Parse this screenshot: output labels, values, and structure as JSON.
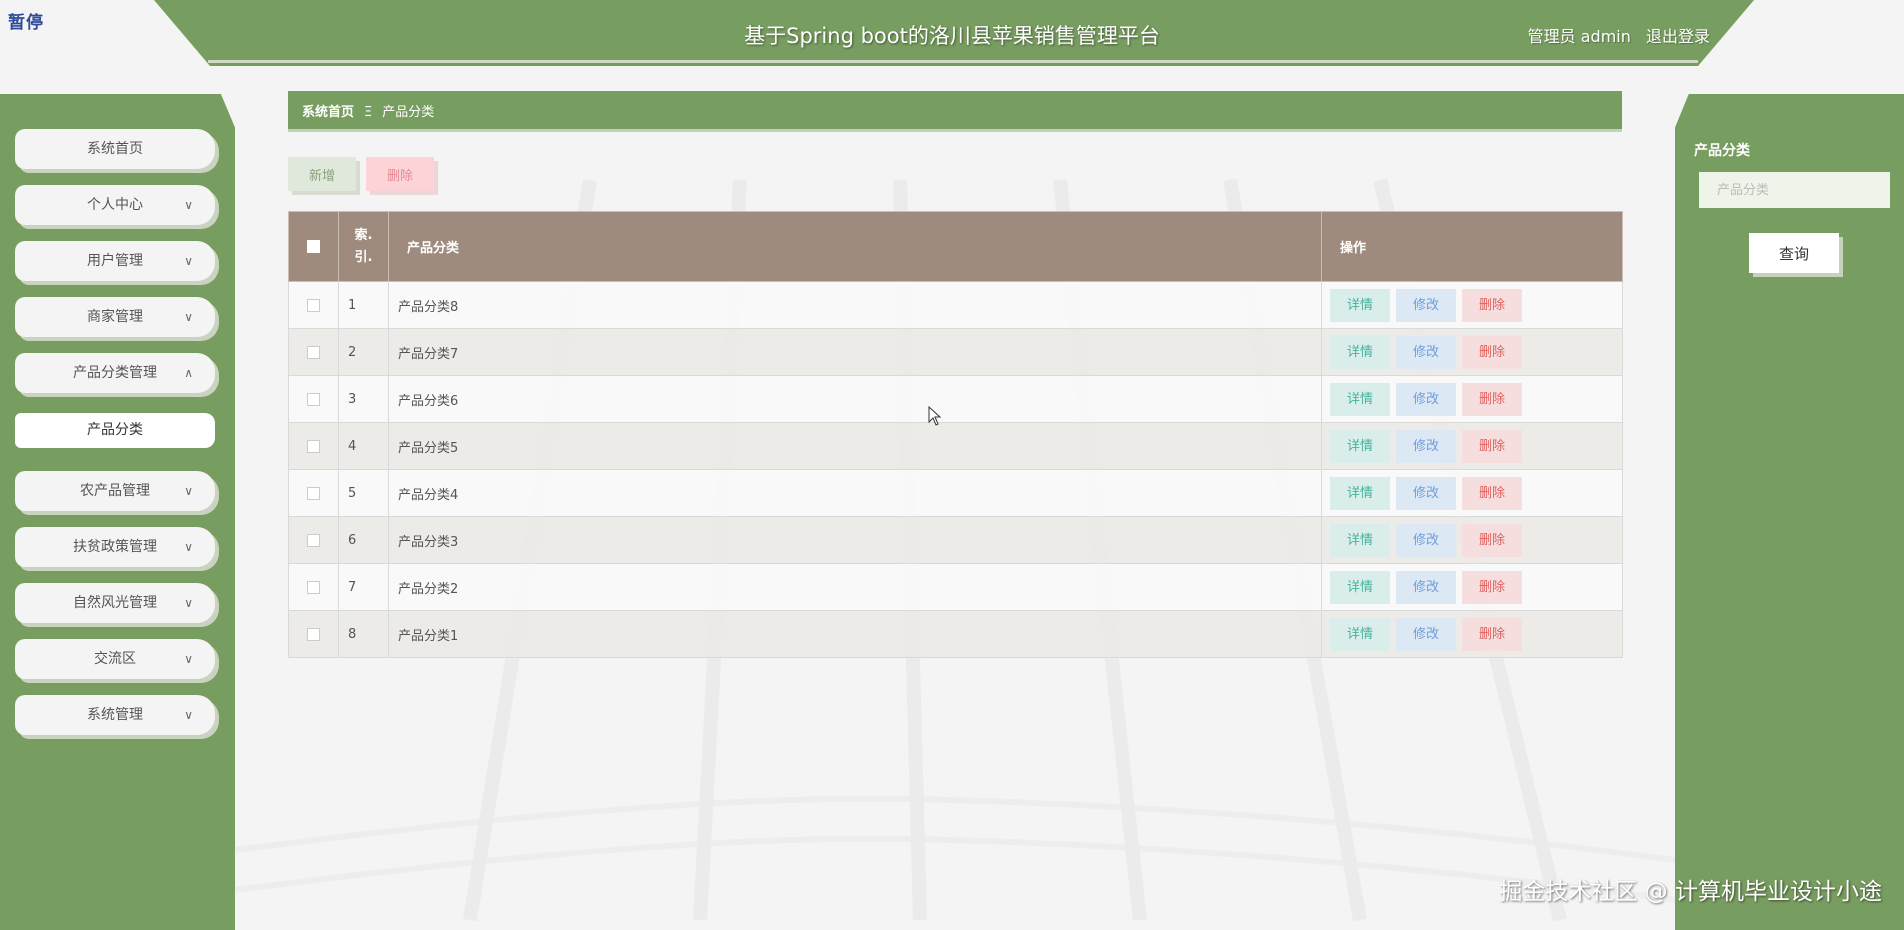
{
  "corner_logo": "暂停",
  "header": {
    "title": "基于Spring boot的洛川县苹果销售管理平台",
    "user_label": "管理员 admin",
    "logout": "退出登录"
  },
  "sidebar": {
    "items": [
      {
        "label": "系统首页"
      },
      {
        "label": "个人中心"
      },
      {
        "label": "用户管理"
      },
      {
        "label": "商家管理"
      },
      {
        "label": "产品分类管理"
      },
      {
        "label": "农产品管理"
      },
      {
        "label": "扶贫政策管理"
      },
      {
        "label": "自然风光管理"
      },
      {
        "label": "交流区"
      },
      {
        "label": "系统管理"
      }
    ],
    "sub_item": "产品分类"
  },
  "breadcrumb": {
    "home": "系统首页",
    "separator": "Ξ",
    "current": "产品分类"
  },
  "toolbar": {
    "add_label": "新增",
    "delete_label": "删除"
  },
  "table": {
    "columns": [
      "索引",
      "产品分类",
      "操作"
    ],
    "index_col_lines": [
      "索.",
      "引."
    ],
    "rows": [
      {
        "index": "1",
        "category": "产品分类8"
      },
      {
        "index": "2",
        "category": "产品分类7"
      },
      {
        "index": "3",
        "category": "产品分类6"
      },
      {
        "index": "4",
        "category": "产品分类5"
      },
      {
        "index": "5",
        "category": "产品分类4"
      },
      {
        "index": "6",
        "category": "产品分类3"
      },
      {
        "index": "7",
        "category": "产品分类2"
      },
      {
        "index": "8",
        "category": "产品分类1"
      }
    ],
    "actions": {
      "detail": "详情",
      "edit": "修改",
      "delete": "删除"
    }
  },
  "search": {
    "label": "产品分类",
    "placeholder": "产品分类",
    "button": "查询"
  },
  "watermark": "掘金技术社区 @ 计算机毕业设计小途",
  "colors": {
    "primary_green": "#789d60",
    "table_header": "#9e8b7d",
    "detail": "#44b39d",
    "edit": "#6e9edb",
    "delete": "#e0605f"
  }
}
